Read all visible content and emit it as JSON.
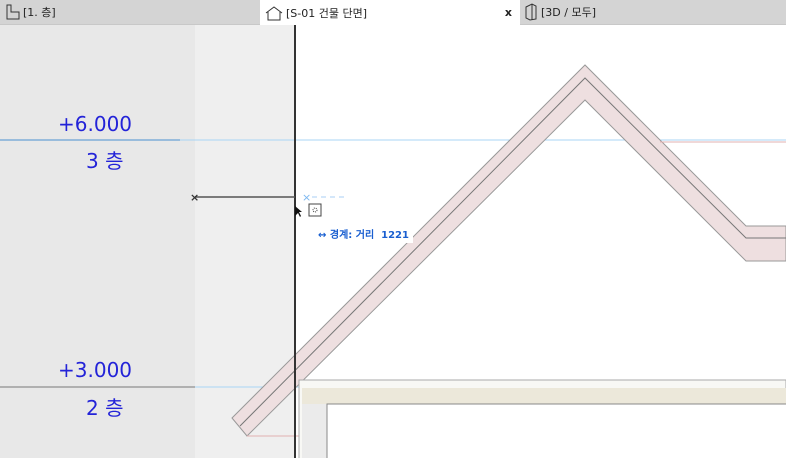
{
  "tabs": [
    {
      "label": "[1. 층]",
      "icon": "floor-plan-icon"
    },
    {
      "label": "[S-01 건물 단면]",
      "icon": "section-icon",
      "active": true,
      "close": "x"
    },
    {
      "label": "[3D / 모두]",
      "icon": "3d-icon"
    }
  ],
  "levels": [
    {
      "elevation": "+6.000",
      "name": "3 층"
    },
    {
      "elevation": "+3.000",
      "name": "2 층"
    }
  ],
  "tooltip": {
    "arrow": "↔",
    "label": "경계: 거리",
    "value": "1221"
  },
  "colors": {
    "level_text": "#2323d8",
    "tooltip_text": "#1a5fd0",
    "roof_fill": "#eedfe0"
  }
}
